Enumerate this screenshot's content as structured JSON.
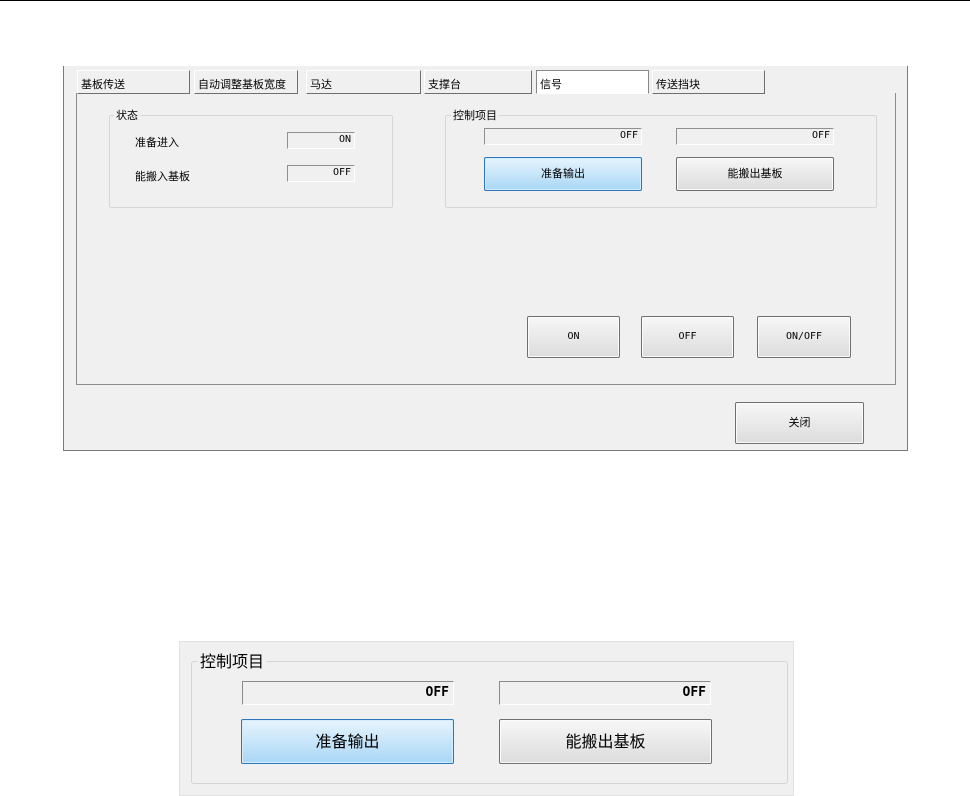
{
  "tabs": [
    "基板传送",
    "自动调整基板宽度",
    "马达",
    "支撑台",
    "信号",
    "传送挡块"
  ],
  "status_group": {
    "title": "状态",
    "rows": [
      {
        "label": "准备进入",
        "value": "ON"
      },
      {
        "label": "能搬入基板",
        "value": "OFF"
      }
    ]
  },
  "control_group": {
    "title": "控制项目",
    "fields": [
      "OFF",
      "OFF"
    ],
    "buttons": [
      "准备输出",
      "能搬出基板"
    ]
  },
  "action_buttons": [
    "ON",
    "OFF",
    "ON/OFF"
  ],
  "close_button": "关闭",
  "zoom": {
    "title": "控制项目",
    "fields": [
      "OFF",
      "OFF"
    ],
    "buttons": [
      "准备输出",
      "能搬出基板"
    ]
  }
}
